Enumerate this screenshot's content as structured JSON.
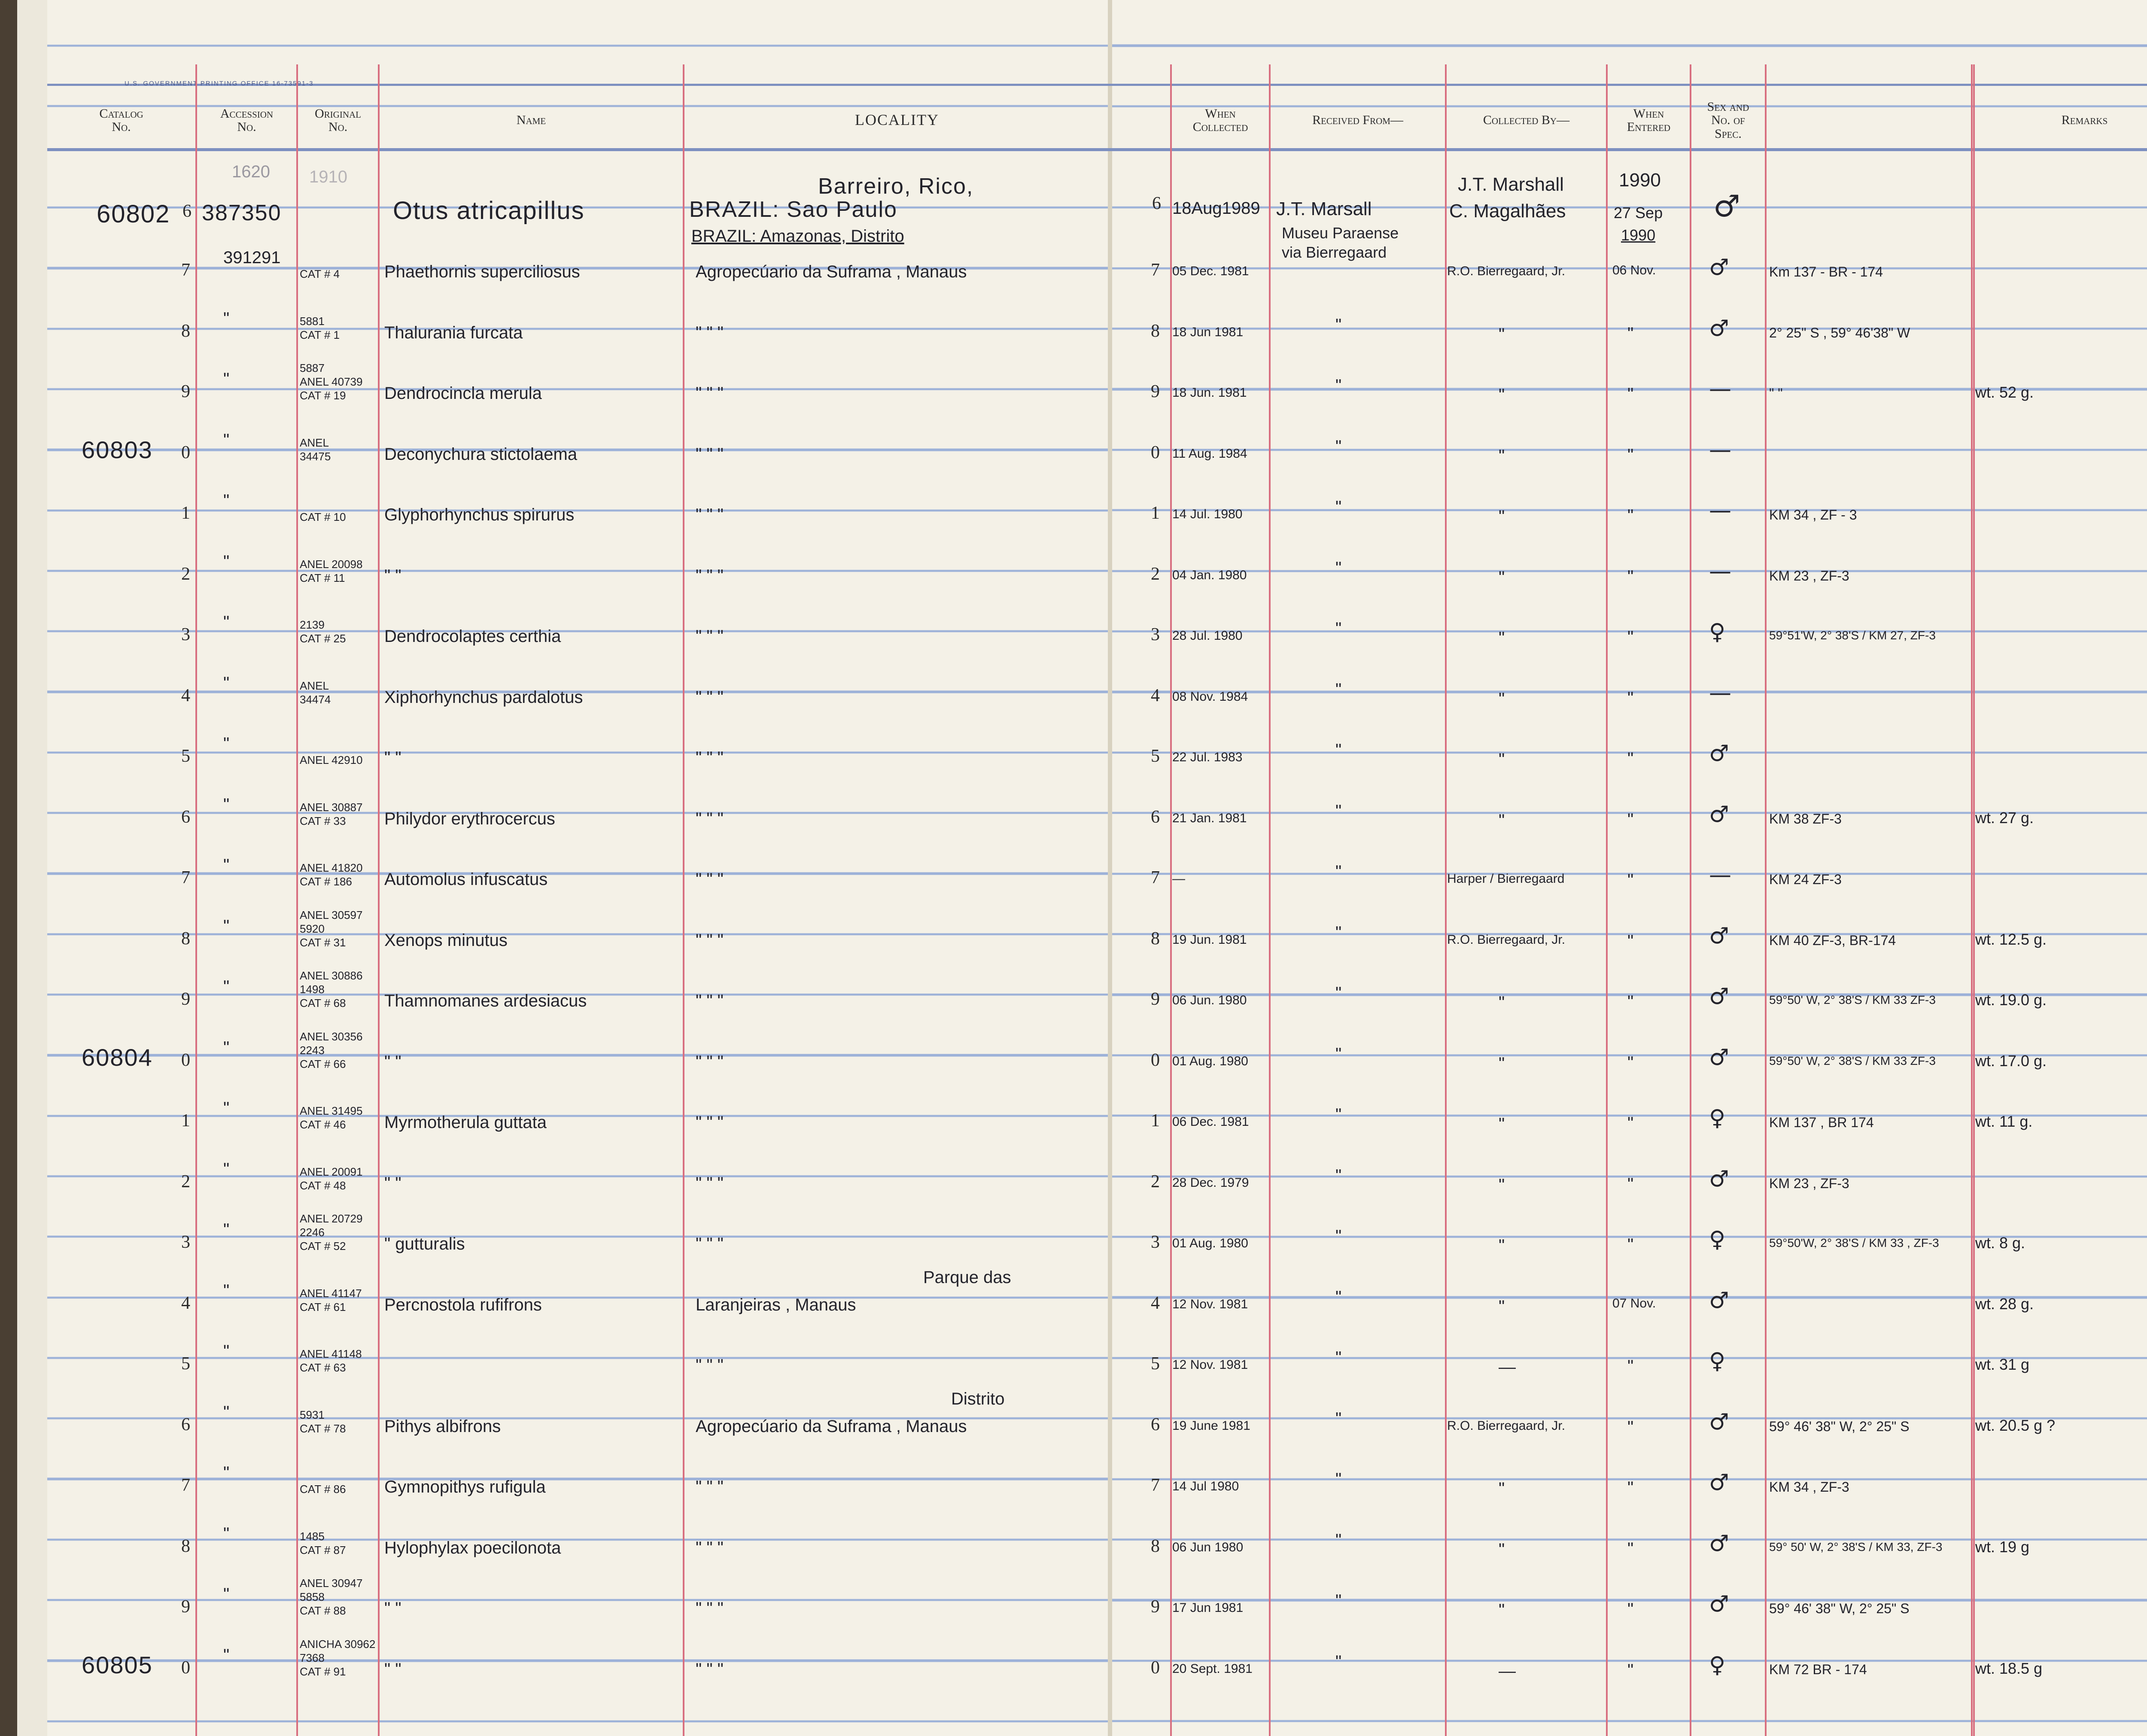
{
  "printer_line": "U.S. GOVERNMENT PRINTING OFFICE 16-73591-3",
  "columns": {
    "catalog": "Catalog\nNo.",
    "accession": "Accession\nNo.",
    "original": "Original\nNo.",
    "name": "Name",
    "locality": "LOCALITY",
    "when_collected": "When\nCollected",
    "received_from": "Received From—",
    "collected_by": "Collected By—",
    "when_entered": "When\nEntered",
    "sex": "Sex and\nNo. of\nSpec.",
    "remarks": "Remarks"
  },
  "first_entry": {
    "accession_above": "1620",
    "original_above": "1910",
    "catalog": "60802",
    "row": "6",
    "accession": "387350",
    "name": "Otus atricapillus",
    "locality_line1": "Barreiro, Rico,",
    "locality_line2": "BRAZIL:  Sao Paulo",
    "when_row": "6",
    "when_collected": "18Aug1989",
    "received_from": "J.T. Marsall",
    "collected_by_line1": "J.T. Marshall",
    "collected_by_line2": "C. Magalhães",
    "entered_year": "1990",
    "entered_day": "27 Sep",
    "entered_year2": "1990",
    "sex": "♂"
  },
  "row6_extra": {
    "locality_line3": "BRAZIL:  Amazonas, Distrito",
    "received_from_line2": "Museu Paraense",
    "received_from_line3": "via Bierregaard"
  },
  "entries": [
    {
      "catalog": "",
      "row": "7",
      "accession": "391291",
      "original": [
        "CAT # 4"
      ],
      "name": "Phaethornis  superciliosus",
      "locality": "Agropecúario  da  Suframa ,  Manaus",
      "when": "05 Dec. 1981",
      "received": "",
      "collected": "R.O. Bierregaard, Jr.",
      "entered": "06 Nov.",
      "sex": "♂",
      "remarks_loc": "Km 137 - BR - 174",
      "remarks_wt": ""
    },
    {
      "catalog": "",
      "row": "8",
      "accession": "\"",
      "original": [
        "5881",
        "CAT # 1"
      ],
      "name": "Thalurania  furcata",
      "locality": "\"                    \"                    \"",
      "when": "18 Jun 1981",
      "received": "\"",
      "collected": "\"",
      "entered": "\"",
      "sex": "♂",
      "remarks_loc": "2° 25\" S ,  59° 46'38\" W",
      "remarks_wt": ""
    },
    {
      "catalog": "",
      "row": "9",
      "accession": "\"",
      "original": [
        "5887",
        "ANEL 40739",
        "CAT # 19"
      ],
      "name": "Dendrocincla  merula",
      "locality": "\"                    \"                    \"",
      "when": "18 Jun. 1981",
      "received": "\"",
      "collected": "\"",
      "entered": "\"",
      "sex": "—",
      "remarks_loc": "\"             \"",
      "remarks_wt": "wt.  52 g."
    },
    {
      "catalog": "60803",
      "row": "0",
      "accession": "\"",
      "original": [
        "ANEL",
        "34475"
      ],
      "name": "Deconychura  stictolaema",
      "locality": "\"                    \"                    \"",
      "when": "11 Aug. 1984",
      "received": "\"",
      "collected": "\"",
      "entered": "\"",
      "sex": "—",
      "remarks_loc": "",
      "remarks_wt": ""
    },
    {
      "catalog": "",
      "row": "1",
      "accession": "\"",
      "original": [
        "CAT # 10"
      ],
      "name": "Glyphorhynchus  spirurus",
      "locality": "\"                    \"                    \"",
      "when": "14 Jul. 1980",
      "received": "\"",
      "collected": "\"",
      "entered": "\"",
      "sex": "—",
      "remarks_loc": "KM 34 ,  ZF - 3",
      "remarks_wt": ""
    },
    {
      "catalog": "",
      "row": "2",
      "accession": "\"",
      "original": [
        "ANEL 20098",
        "CAT # 11"
      ],
      "name": "\"            \"",
      "locality": "\"                    \"                    \"",
      "when": "04 Jan. 1980",
      "received": "\"",
      "collected": "\"",
      "entered": "\"",
      "sex": "—",
      "remarks_loc": "KM 23 ,  ZF-3",
      "remarks_wt": ""
    },
    {
      "catalog": "",
      "row": "3",
      "accession": "\"",
      "original": [
        "2139",
        "CAT # 25"
      ],
      "name": "Dendrocolaptes  certhia",
      "locality": "\"                    \"                    \"",
      "when": "28 Jul. 1980",
      "received": "\"",
      "collected": "\"",
      "entered": "\"",
      "sex": "♀",
      "remarks_loc": "59°51'W, 2° 38'S  /  KM 27,  ZF-3",
      "remarks_wt": ""
    },
    {
      "catalog": "",
      "row": "4",
      "accession": "\"",
      "original": [
        "ANEL",
        "34474"
      ],
      "name": "Xiphorhynchus  pardalotus",
      "locality": "\"                    \"                    \"",
      "when": "08 Nov. 1984",
      "received": "\"",
      "collected": "\"",
      "entered": "\"",
      "sex": "—",
      "remarks_loc": "",
      "remarks_wt": ""
    },
    {
      "catalog": "",
      "row": "5",
      "accession": "\"",
      "original": [
        "ANEL 42910"
      ],
      "name": "\"            \"",
      "locality": "\"                    \"                    \"",
      "when": "22 Jul. 1983",
      "received": "\"",
      "collected": "\"",
      "entered": "\"",
      "sex": "♂",
      "remarks_loc": "",
      "remarks_wt": ""
    },
    {
      "catalog": "",
      "row": "6",
      "accession": "\"",
      "original": [
        "ANEL 30887",
        "CAT # 33"
      ],
      "name": "Philydor  erythrocercus",
      "locality": "\"                    \"                    \"",
      "when": "21 Jan. 1981",
      "received": "\"",
      "collected": "\"",
      "entered": "\"",
      "sex": "♂",
      "remarks_loc": "KM 38  ZF-3",
      "remarks_wt": "wt.  27 g."
    },
    {
      "catalog": "",
      "row": "7",
      "accession": "\"",
      "original": [
        "ANEL 41820",
        "CAT # 186"
      ],
      "name": "Automolus  infuscatus",
      "locality": "\"                    \"                    \"",
      "when": "—",
      "received": "\"",
      "collected": "Harper / Bierregaard",
      "entered": "\"",
      "sex": "—",
      "remarks_loc": "KM 24  ZF-3",
      "remarks_wt": ""
    },
    {
      "catalog": "",
      "row": "8",
      "accession": "\"",
      "original": [
        "ANEL 30597",
        "5920",
        "CAT # 31"
      ],
      "name": "Xenops  minutus",
      "locality": "\"                    \"                    \"",
      "when": "19 Jun. 1981",
      "received": "\"",
      "collected": "R.O. Bierregaard, Jr.",
      "entered": "\"",
      "sex": "♂",
      "remarks_loc": "KM 40  ZF-3,  BR-174",
      "remarks_wt": "wt.  12.5 g."
    },
    {
      "catalog": "",
      "row": "9",
      "accession": "\"",
      "original": [
        "ANEL 30886",
        "1498",
        "CAT # 68"
      ],
      "name": "Thamnomanes  ardesiacus",
      "locality": "\"                    \"                    \"",
      "when": "06 Jun. 1980",
      "received": "\"",
      "collected": "\"",
      "entered": "\"",
      "sex": "♂",
      "remarks_loc": "59°50' W, 2° 38'S  /  KM 33  ZF-3",
      "remarks_wt": "wt.  19.0 g."
    },
    {
      "catalog": "60804",
      "row": "0",
      "accession": "\"",
      "original": [
        "ANEL 30356",
        "2243",
        "CAT # 66"
      ],
      "name": "\"            \"",
      "locality": "\"                    \"                    \"",
      "when": "01 Aug. 1980",
      "received": "\"",
      "collected": "\"",
      "entered": "\"",
      "sex": "♂",
      "remarks_loc": "59°50' W, 2° 38'S  /  KM 33  ZF-3",
      "remarks_wt": "wt.  17.0 g."
    },
    {
      "catalog": "",
      "row": "1",
      "accession": "\"",
      "original": [
        "ANEL 31495",
        "CAT # 46"
      ],
      "name": "Myrmotherula  guttata",
      "locality": "\"                    \"                    \"",
      "when": "06 Dec. 1981",
      "received": "\"",
      "collected": "\"",
      "entered": "\"",
      "sex": "♀",
      "remarks_loc": "KM 137 ,  BR 174",
      "remarks_wt": "wt.  11 g."
    },
    {
      "catalog": "",
      "row": "2",
      "accession": "\"",
      "original": [
        "ANEL 20091",
        "CAT # 48"
      ],
      "name": "\"            \"",
      "locality": "\"                    \"                    \"",
      "when": "28 Dec. 1979",
      "received": "\"",
      "collected": "\"",
      "entered": "\"",
      "sex": "♂",
      "remarks_loc": "KM 23 ,  ZF-3",
      "remarks_wt": ""
    },
    {
      "catalog": "",
      "row": "3",
      "accession": "\"",
      "original": [
        "ANEL 20729",
        "2246",
        "CAT # 52"
      ],
      "name": "\"         gutturalis",
      "locality": "\"                    \"                    \"",
      "when": "01 Aug. 1980",
      "received": "\"",
      "collected": "\"",
      "entered": "\"",
      "sex": "♀",
      "remarks_loc": "59°50'W, 2° 38'S  /  KM 33 , ZF-3",
      "remarks_wt": "wt.  8 g."
    },
    {
      "catalog": "",
      "row": "4",
      "accession": "\"",
      "original": [
        "ANEL 41147",
        "CAT # 61"
      ],
      "name": "Percnostola  rufifrons",
      "locality": "Laranjeiras ,  Manaus",
      "when": "12 Nov. 1981",
      "received": "\"",
      "collected": "\"",
      "entered": "07 Nov.",
      "sex": "♂",
      "remarks_loc": "",
      "remarks_wt": "wt.  28 g."
    },
    {
      "catalog": "",
      "row": "5",
      "accession": "\"",
      "original": [
        "ANEL 41148",
        "CAT # 63"
      ],
      "name": "",
      "locality": "\"                    \"                    \"",
      "when": "12 Nov. 1981",
      "received": "\"",
      "collected": "—",
      "entered": "\"",
      "sex": "♀",
      "remarks_loc": "",
      "remarks_wt": "wt.  31 g"
    },
    {
      "catalog": "",
      "row": "6",
      "accession": "\"",
      "original": [
        "5931",
        "CAT # 78"
      ],
      "name": "Pithys  albifrons",
      "locality": "Agropecúario  da  Suframa ,  Manaus",
      "when": "19 June 1981",
      "received": "\"",
      "collected": "R.O. Bierregaard, Jr.",
      "entered": "\"",
      "sex": "♂",
      "remarks_loc": "59° 46' 38\" W, 2° 25\" S",
      "remarks_wt": "wt.  20.5 g ?"
    },
    {
      "catalog": "",
      "row": "7",
      "accession": "\"",
      "original": [
        "CAT # 86"
      ],
      "name": "Gymnopithys  rufigula",
      "locality": "\"                    \"                    \"",
      "when": "14 Jul 1980",
      "received": "\"",
      "collected": "\"",
      "entered": "\"",
      "sex": "♂",
      "remarks_loc": "KM 34 ,  ZF-3",
      "remarks_wt": ""
    },
    {
      "catalog": "",
      "row": "8",
      "accession": "\"",
      "original": [
        "1485",
        "CAT # 87"
      ],
      "name": "Hylophylax  poecilonota",
      "locality": "\"                    \"                    \"",
      "when": "06 Jun 1980",
      "received": "\"",
      "collected": "\"",
      "entered": "\"",
      "sex": "♂",
      "remarks_loc": "59° 50' W, 2° 38'S  /  KM 33, ZF-3",
      "remarks_wt": "wt.  19 g"
    },
    {
      "catalog": "",
      "row": "9",
      "accession": "\"",
      "original": [
        "ANEL 30947",
        "5858",
        "CAT # 88"
      ],
      "name": "\"            \"",
      "locality": "\"                    \"                    \"",
      "when": "17 Jun 1981",
      "received": "\"",
      "collected": "\"",
      "entered": "\"",
      "sex": "♂",
      "remarks_loc": "59° 46' 38\" W, 2° 25\" S",
      "remarks_wt": ""
    },
    {
      "catalog": "60805",
      "row": "0",
      "accession": "\"",
      "original": [
        "ANICHA 30962",
        "7368",
        "CAT # 91"
      ],
      "name": "\"            \"",
      "locality": "\"                    \"                    \"",
      "when": "20 Sept. 1981",
      "received": "\"",
      "collected": "—",
      "entered": "\"",
      "sex": "♀",
      "remarks_loc": "KM 72  BR - 174",
      "remarks_wt": "wt.  18.5 g"
    }
  ],
  "interline": {
    "parque": "Parque  das",
    "distrito": "Distrito"
  }
}
